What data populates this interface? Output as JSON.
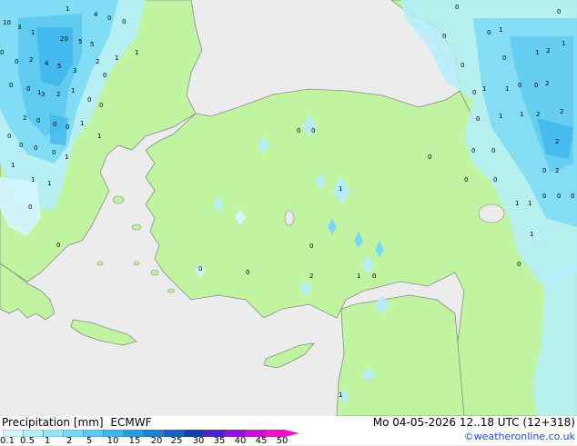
{
  "footer": {
    "product": "Precipitation [mm]",
    "model": "ECMWF",
    "datetime": "Mo 04-05-2026 12..18 UTC (12+318)",
    "credit": "©weatheronline.co.uk"
  },
  "legend": {
    "labels": [
      "0.1",
      "0.5",
      "1",
      "2",
      "5",
      "10",
      "15",
      "20",
      "25",
      "30",
      "35",
      "40",
      "45",
      "50"
    ],
    "colors": [
      "#d2f5ff",
      "#b4eefc",
      "#96e4f8",
      "#78d8f4",
      "#5ac8f0",
      "#3cb4ec",
      "#289ae0",
      "#1e7ed2",
      "#1860c4",
      "#1040b0",
      "#5020c8",
      "#9010d8",
      "#c810d8",
      "#f010c8"
    ]
  },
  "map_values": [
    "10",
    "3",
    "1",
    "1",
    "4",
    "0",
    "0",
    "20",
    "5",
    "5",
    "1",
    "0",
    "0",
    "2",
    "4",
    "5",
    "3",
    "2",
    "0",
    "1",
    "0",
    "0",
    "1",
    "3",
    "2",
    "1",
    "0",
    "0",
    "2",
    "0",
    "0",
    "0",
    "1",
    "1",
    "0",
    "0",
    "0",
    "0",
    "1",
    "1",
    "1",
    "1",
    "0",
    "0",
    "0",
    "0",
    "1",
    "0",
    "0",
    "0",
    "2",
    "1",
    "0",
    "1",
    "0",
    "0",
    "0",
    "1",
    "0",
    "0",
    "1",
    "1",
    "2",
    "2",
    "0",
    "1",
    "1",
    "0",
    "0",
    "0",
    "1",
    "2",
    "0",
    "1",
    "2",
    "2",
    "2",
    "0",
    "0",
    "0",
    "1",
    "1",
    "0",
    "0",
    "0",
    "0",
    "0",
    "1",
    "0",
    "0"
  ],
  "colors": {
    "land": "#c0f4a0",
    "sea": "#ececec",
    "coast": "#8a8a8a"
  }
}
